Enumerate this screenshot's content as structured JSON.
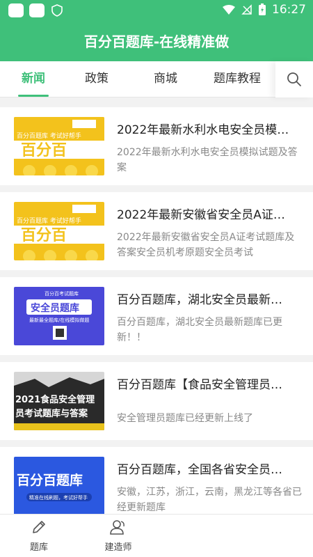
{
  "status": {
    "time": "16:27"
  },
  "header": {
    "title": "百分百题库-在线精准做"
  },
  "tabs": [
    {
      "label": "新闻",
      "active": true
    },
    {
      "label": "政策",
      "active": false
    },
    {
      "label": "商城",
      "active": false
    },
    {
      "label": "题库教程",
      "active": false
    }
  ],
  "news": [
    {
      "title": "2022年最新水利水电安全员模…",
      "desc": "2022年最新水利水电安全员模拟试题及答案",
      "thumb": {
        "line1": "百分百题库 考试好帮手",
        "line2": "百分百"
      }
    },
    {
      "title": "2022年最新安徽省安全员A证…",
      "desc": "2022年最新安徽省安全员A证考试题库及答案安全员机考原题安全员考试",
      "thumb": {
        "line1": "百分百题库 考试好帮手",
        "line2": "百分百"
      }
    },
    {
      "title": "百分百题库，湖北安全员最新…",
      "desc": "百分百题库，湖北安全员最新题库已更新！！",
      "thumb": {
        "line1": "百分百考试题库",
        "line2": "安全员题库",
        "line3": "最新最全题库/在线模拟做题"
      }
    },
    {
      "title": "百分百题库【食品安全管理员…",
      "desc": "安全管理员题库已经更新上线了",
      "thumb": {
        "line1": "2021食品安全管理",
        "line2": "员考试题库与答案"
      }
    },
    {
      "title": "百分百题库，全国各省安全员…",
      "desc": "安徽，江苏，浙江，云南，黑龙江等各省已经更新题库",
      "thumb": {
        "line1": "百分百题库",
        "line2": "精准在线刷题，考试好帮手"
      }
    }
  ],
  "bottom_nav": [
    {
      "label": "题库",
      "icon": "pencil-icon"
    },
    {
      "label": "建造师",
      "icon": "users-icon"
    }
  ],
  "colors": {
    "accent": "#3fc07a"
  }
}
